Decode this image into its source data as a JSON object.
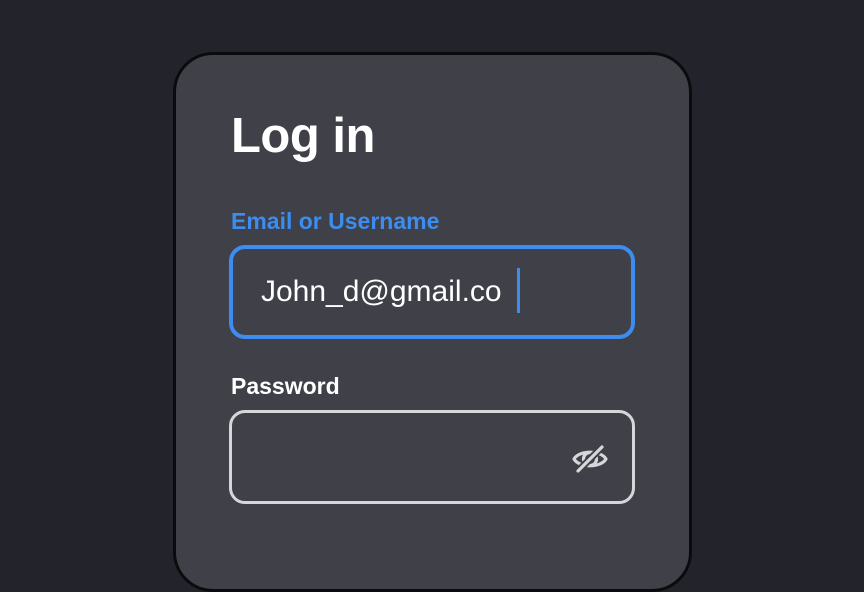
{
  "login": {
    "title": "Log in",
    "email_label": "Email or Username",
    "email_value": "John_d@gmail.co",
    "password_label": "Password",
    "password_value": "",
    "password_toggle_icon": "eye-off-icon"
  },
  "colors": {
    "page_background": "#23242b",
    "card_background": "#3f4048",
    "accent": "#3d8cf0",
    "text": "#ffffff",
    "field_border_idle": "#d7d7d9"
  }
}
